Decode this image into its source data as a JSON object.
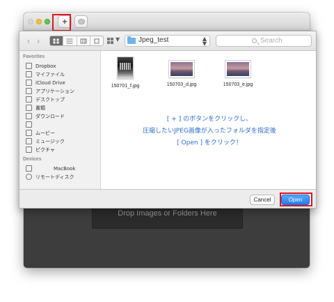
{
  "window": {
    "add_button_label": "+",
    "dropzone_text": "Drop Images or Folders Here"
  },
  "dialog": {
    "toolbar": {
      "back": "‹",
      "forward": "›",
      "path_popup": "Jpeg_test",
      "search_placeholder": "Search"
    },
    "sidebar": {
      "favorites_header": "Favorites",
      "favorites": [
        {
          "label": "Dropbox",
          "icon": "folder-icon"
        },
        {
          "label": "マイファイル",
          "icon": "my-files-icon"
        },
        {
          "label": "iCloud Drive",
          "icon": "cloud-icon"
        },
        {
          "label": "アプリケーション",
          "icon": "applications-icon"
        },
        {
          "label": "デスクトップ",
          "icon": "desktop-icon"
        },
        {
          "label": "書類",
          "icon": "documents-icon"
        },
        {
          "label": "ダウンロード",
          "icon": "downloads-icon"
        },
        {
          "label": "",
          "icon": "home-icon"
        },
        {
          "label": "ムービー",
          "icon": "movies-icon"
        },
        {
          "label": "ミュージック",
          "icon": "music-icon"
        },
        {
          "label": "ピクチャ",
          "icon": "pictures-icon"
        }
      ],
      "devices_header": "Devices",
      "devices": [
        {
          "label": "MacBook",
          "icon": "laptop-icon"
        },
        {
          "label": "リモートディスク",
          "icon": "disc-icon"
        }
      ]
    },
    "files": [
      {
        "name": "150701_f.jpg"
      },
      {
        "name": "150703_d.jpg"
      },
      {
        "name": "150703_e.jpg"
      }
    ],
    "instruction": {
      "line1": "[ + ] のボタンをクリックし、",
      "line2": "圧縮したいJPEG画像が入ったフォルダを指定後",
      "line3": "[ Open ] をクリック！"
    },
    "buttons": {
      "cancel": "Cancel",
      "open": "Open"
    }
  },
  "colors": {
    "highlight": "#e0151b",
    "instruction_text": "#2a6bd6",
    "primary_button": "#1e7cf3"
  }
}
